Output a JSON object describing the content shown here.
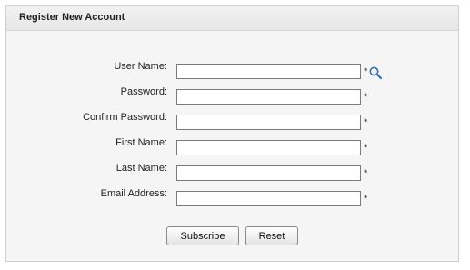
{
  "panel": {
    "title": "Register New Account"
  },
  "form": {
    "fields": [
      {
        "label": "User Name:",
        "value": "",
        "required": "*"
      },
      {
        "label": "Password:",
        "value": "",
        "required": "*"
      },
      {
        "label": "Confirm Password:",
        "value": "",
        "required": "*"
      },
      {
        "label": "First Name:",
        "value": "",
        "required": "*"
      },
      {
        "label": "Last Name:",
        "value": "",
        "required": "*"
      },
      {
        "label": "Email Address:",
        "value": "",
        "required": "*"
      }
    ],
    "lookup_icon": "magnifier-icon",
    "buttons": {
      "subscribe": "Subscribe",
      "reset": "Reset"
    }
  }
}
